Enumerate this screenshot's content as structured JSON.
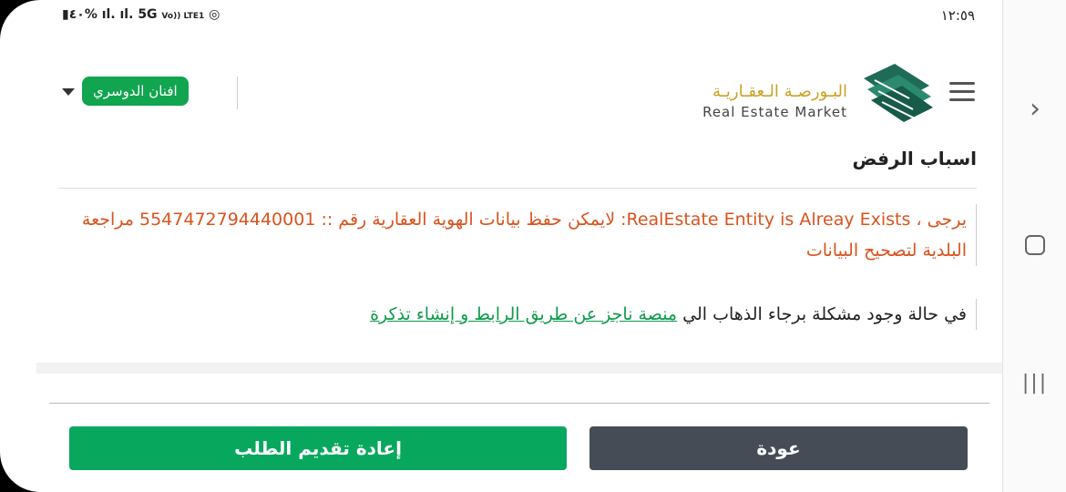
{
  "status_bar": {
    "time": "١٢:٥٩",
    "battery": "٤٠%",
    "network": "5G",
    "volte": "Vo)) LTE1"
  },
  "header": {
    "logo_ar": "البـورصـة الـعقـاريـة",
    "logo_en": "Real Estate Market",
    "user_name": "افنان الدوسري",
    "brand_green": "#12a54f",
    "brand_gold": "#c9a227"
  },
  "content": {
    "section_title": "اسباب الرفض",
    "error_message": "يرجى ، RealEstate Entity is Alreay Exists: لايمكن حفظ بيانات الهوية العقارية رقم :: 5547472794440001 مراجعة البلدية لتصحيح البيانات",
    "help_prefix": "في حالة وجود مشكلة برجاء الذهاب الي ",
    "help_link": "منصة ناجز عن طريق الرابط و إنشاء تذكرة"
  },
  "actions": {
    "resubmit_label": "إعادة تقديم الطلب",
    "back_label": "عودة"
  }
}
